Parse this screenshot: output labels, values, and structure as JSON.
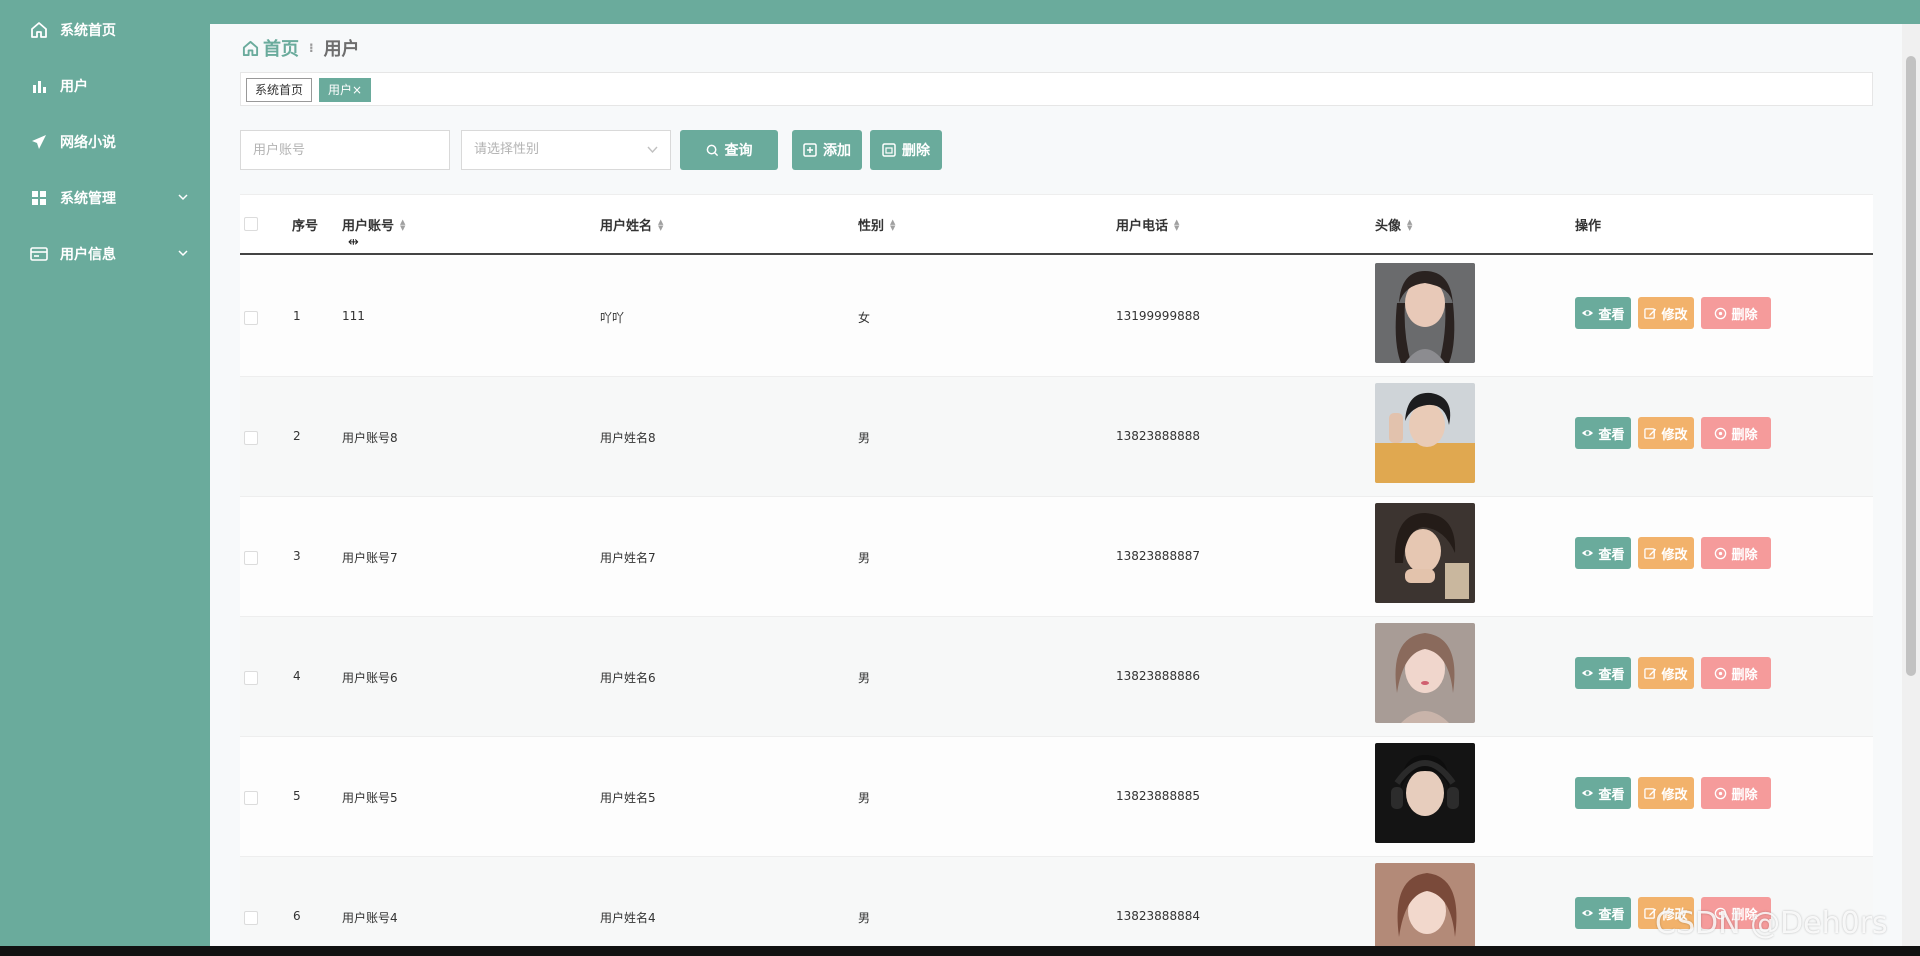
{
  "sidebar": {
    "items": [
      {
        "label": "系统首页",
        "icon": "home-icon"
      },
      {
        "label": "用户",
        "icon": "bar-chart-icon"
      },
      {
        "label": "网络小说",
        "icon": "paper-plane-icon"
      },
      {
        "label": "系统管理",
        "icon": "grid-icon",
        "expandable": true
      },
      {
        "label": "用户信息",
        "icon": "card-icon",
        "expandable": true
      }
    ]
  },
  "breadcrumb": {
    "home": "首页",
    "separator": "⁝",
    "current": "用户"
  },
  "tags": [
    {
      "label": "系统首页"
    },
    {
      "label": "用户",
      "close": "×"
    }
  ],
  "search": {
    "account_placeholder": "用户账号",
    "gender_placeholder": "请选择性别",
    "query_label": "查询",
    "add_label": "添加",
    "delete_label": "删除"
  },
  "table": {
    "headers": {
      "index": "序号",
      "account": "用户账号",
      "name": "用户姓名",
      "gender": "性别",
      "phone": "用户电话",
      "avatar": "头像",
      "actions": "操作"
    },
    "action_labels": {
      "view": "查看",
      "edit": "修改",
      "delete": "删除"
    },
    "rows": [
      {
        "index": "1",
        "account": "111",
        "name": "吖吖",
        "gender": "女",
        "phone": "13199999888"
      },
      {
        "index": "2",
        "account": "用户账号8",
        "name": "用户姓名8",
        "gender": "男",
        "phone": "13823888888"
      },
      {
        "index": "3",
        "account": "用户账号7",
        "name": "用户姓名7",
        "gender": "男",
        "phone": "13823888887"
      },
      {
        "index": "4",
        "account": "用户账号6",
        "name": "用户姓名6",
        "gender": "男",
        "phone": "13823888886"
      },
      {
        "index": "5",
        "account": "用户账号5",
        "name": "用户姓名5",
        "gender": "男",
        "phone": "13823888885"
      },
      {
        "index": "6",
        "account": "用户账号4",
        "name": "用户姓名4",
        "gender": "男",
        "phone": "13823888884"
      }
    ]
  },
  "watermark": "CSDN @Deh0rs",
  "colors": {
    "primary": "#6aab9c",
    "warning": "#f2b26b",
    "danger": "#f59b9b"
  }
}
